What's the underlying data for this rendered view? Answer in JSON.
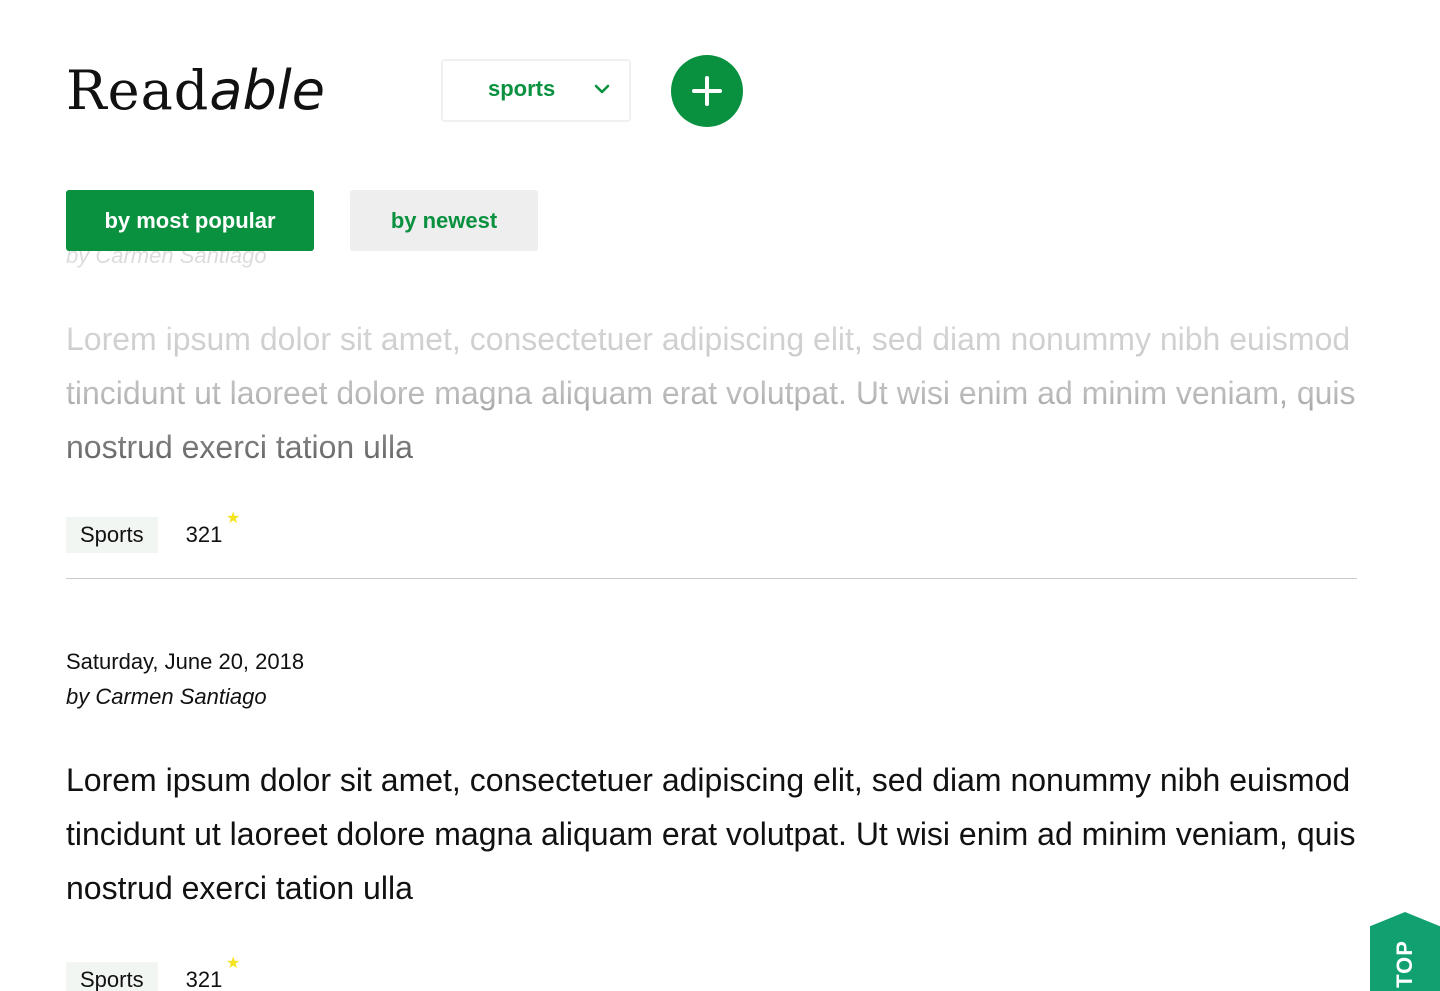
{
  "app": {
    "brand_prefix": "Read",
    "brand_accent": "able"
  },
  "category_filter": {
    "selected": "sports",
    "icon": "chevron-down-icon"
  },
  "add_button": {
    "icon": "plus-icon",
    "color": "#0a9140"
  },
  "sort": {
    "options": [
      {
        "label": "by most popular",
        "active": true
      },
      {
        "label": "by newest",
        "active": false
      }
    ]
  },
  "posts": [
    {
      "author": "by Carmen Santiago",
      "body": "Lorem ipsum dolor sit amet, consectetuer adipiscing elit, sed diam nonummy nibh euismod tincidunt ut laoreet dolore magna aliquam erat volutpat. Ut wisi enim ad minim veniam, quis nostrud exerci tation ulla",
      "category": "Sports",
      "score": "321"
    },
    {
      "date": "Saturday, June 20, 2018",
      "author": "by Carmen Santiago",
      "body": "Lorem ipsum dolor sit amet, consectetuer adipiscing elit, sed diam nonummy nibh euismod tincidunt ut laoreet dolore magna aliquam erat volutpat. Ut wisi enim ad minim veniam, quis nostrud exerci tation ulla",
      "category": "Sports",
      "score": "321"
    }
  ],
  "star_glyph": "★",
  "top_button": {
    "label": "TOP",
    "color": "#11a070"
  },
  "colors": {
    "brand_green": "#0a9140",
    "star": "#f5e31e",
    "tag_bg": "#f1f6f3"
  }
}
